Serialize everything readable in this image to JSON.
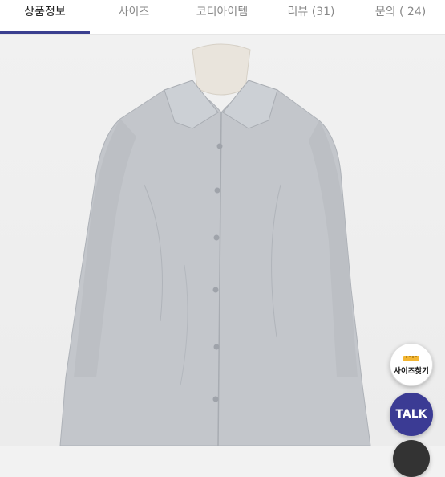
{
  "tabs": [
    {
      "label": "상품정보",
      "active": true
    },
    {
      "label": "사이즈",
      "active": false
    },
    {
      "label": "코디아이템",
      "active": false
    },
    {
      "label": "리뷰 (31)",
      "active": false
    },
    {
      "label": "문의 ( 24)",
      "active": false
    }
  ],
  "colors": {
    "accent": "#3a3f8f",
    "talk_bg": "#3b3b94",
    "shirt": "#c3c6cb",
    "background": "#f2f2f2"
  },
  "floating_buttons": {
    "size_finder_label": "사이즈찾기",
    "talk_label": "TALK"
  },
  "product_image": {
    "subject": "grey-collared-button-shirt-on-mannequin"
  }
}
